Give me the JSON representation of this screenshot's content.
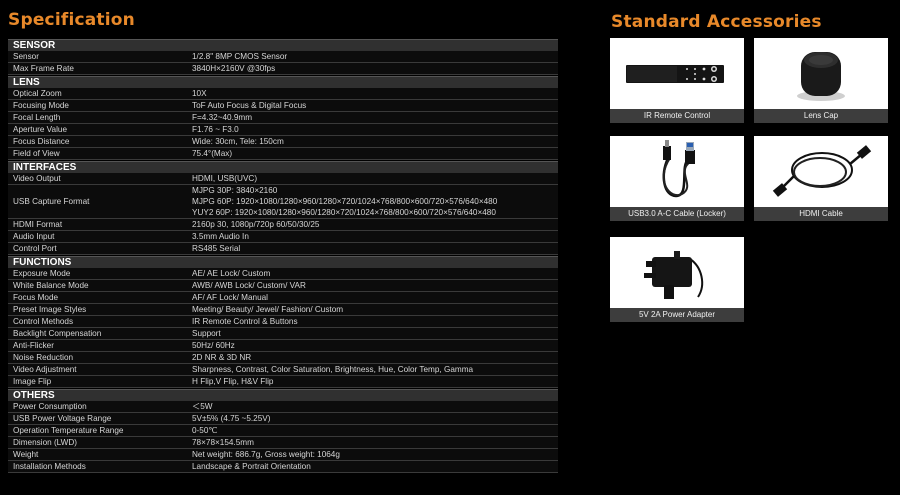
{
  "spec_title": "Specification",
  "acc_title": "Standard Accessories",
  "sections": [
    {
      "name": "SENSOR",
      "rows": [
        {
          "k": "Sensor",
          "v": [
            "1/2.8\" 8MP CMOS Sensor"
          ]
        },
        {
          "k": "Max Frame Rate",
          "v": [
            "3840H×2160V @30fps"
          ]
        }
      ]
    },
    {
      "name": "LENS",
      "rows": [
        {
          "k": "Optical Zoom",
          "v": [
            "10X"
          ]
        },
        {
          "k": "Focusing Mode",
          "v": [
            "ToF Auto Focus & Digital Focus"
          ]
        },
        {
          "k": "Focal Length",
          "v": [
            "F=4.32~40.9mm"
          ]
        },
        {
          "k": "Aperture Value",
          "v": [
            "F1.76 ~ F3.0"
          ]
        },
        {
          "k": "Focus Distance",
          "v": [
            "Wide: 30cm, Tele: 150cm"
          ]
        },
        {
          "k": "Field of View",
          "v": [
            "75.4°(Max)"
          ]
        }
      ]
    },
    {
      "name": "INTERFACES",
      "rows": [
        {
          "k": "Video Output",
          "v": [
            "HDMI, USB(UVC)"
          ]
        },
        {
          "k": "USB Capture Format",
          "v": [
            "MJPG 30P: 3840×2160",
            "MJPG 60P: 1920×1080/1280×960/1280×720/1024×768/800×600/720×576/640×480",
            "YUY2 60P: 1920×1080/1280×960/1280×720/1024×768/800×600/720×576/640×480"
          ]
        },
        {
          "k": "HDMI Format",
          "v": [
            "2160p 30, 1080p/720p 60/50/30/25"
          ]
        },
        {
          "k": "Audio Input",
          "v": [
            "3.5mm Audio In"
          ]
        },
        {
          "k": "Control Port",
          "v": [
            "RS485 Serial"
          ]
        }
      ]
    },
    {
      "name": "FUNCTIONS",
      "rows": [
        {
          "k": "Exposure Mode",
          "v": [
            "AE/ AE Lock/ Custom"
          ]
        },
        {
          "k": "White Balance Mode",
          "v": [
            "AWB/ AWB Lock/ Custom/ VAR"
          ]
        },
        {
          "k": "Focus Mode",
          "v": [
            "AF/ AF Lock/ Manual"
          ]
        },
        {
          "k": "Preset Image Styles",
          "v": [
            "Meeting/ Beauty/ Jewel/ Fashion/ Custom"
          ]
        },
        {
          "k": "Control Methods",
          "v": [
            "IR Remote Control & Buttons"
          ]
        },
        {
          "k": "Backlight Compensation",
          "v": [
            "Support"
          ]
        },
        {
          "k": "Anti-Flicker",
          "v": [
            "50Hz/ 60Hz"
          ]
        },
        {
          "k": "Noise Reduction",
          "v": [
            "2D NR & 3D NR"
          ]
        },
        {
          "k": "Video Adjustment",
          "v": [
            "Sharpness, Contrast, Color Saturation, Brightness, Hue, Color Temp, Gamma"
          ]
        },
        {
          "k": "Image Flip",
          "v": [
            "H Flip,V Flip, H&V Flip"
          ]
        }
      ]
    },
    {
      "name": "OTHERS",
      "rows": [
        {
          "k": "Power Consumption",
          "v": [
            "＜5W"
          ]
        },
        {
          "k": "USB Power Voltage Range",
          "v": [
            "5V±5% (4.75 ~5.25V)"
          ]
        },
        {
          "k": "Operation Temperature Range",
          "v": [
            "0-50℃"
          ]
        },
        {
          "k": "Dimension (LWD)",
          "v": [
            "78×78×154.5mm"
          ]
        },
        {
          "k": "Weight",
          "v": [
            "Net weight: 686.7g, Gross weight: 1064g"
          ]
        },
        {
          "k": "Installation Methods",
          "v": [
            "Landscape & Portrait Orientation"
          ]
        }
      ]
    }
  ],
  "accessories": [
    {
      "label": "IR Remote Control",
      "icon": "remote-control-icon"
    },
    {
      "label": "Lens Cap",
      "icon": "lens-cap-icon"
    },
    {
      "label": "USB3.0 A-C Cable (Locker)",
      "icon": "usb-cable-icon"
    },
    {
      "label": "HDMI Cable",
      "icon": "hdmi-cable-icon"
    },
    {
      "label": "5V 2A Power Adapter",
      "icon": "power-adapter-icon"
    }
  ],
  "colors": {
    "accent": "#e8892a",
    "section_bg": "#303030",
    "caption_bg": "#3d3d3d"
  }
}
